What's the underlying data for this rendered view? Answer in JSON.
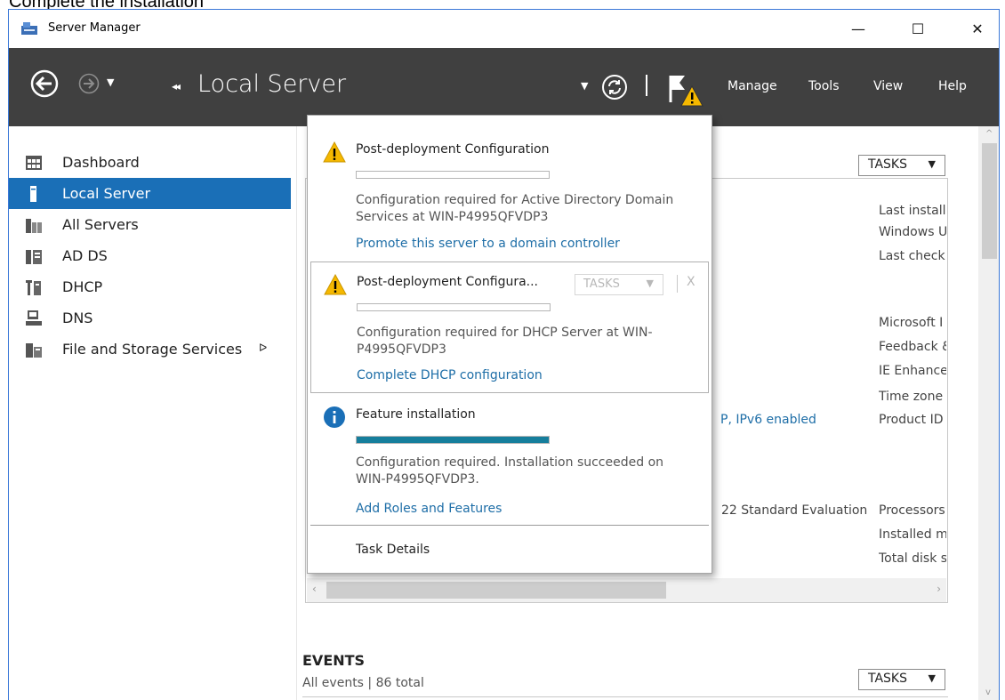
{
  "caption": "Complete the installation",
  "window": {
    "title": "Server Manager",
    "controls": {
      "minimize": "—",
      "maximize": "☐",
      "close": "✕"
    }
  },
  "header": {
    "breadcrumb_arrows": "◂◂",
    "title": "Local Server",
    "menu": [
      "Manage",
      "Tools",
      "View",
      "Help"
    ]
  },
  "sidebar": {
    "items": [
      {
        "label": "Dashboard",
        "icon": "dashboard-icon",
        "active": false
      },
      {
        "label": "Local Server",
        "icon": "local-server-icon",
        "active": true
      },
      {
        "label": "All Servers",
        "icon": "all-servers-icon",
        "active": false
      },
      {
        "label": "AD DS",
        "icon": "ad-ds-icon",
        "active": false
      },
      {
        "label": "DHCP",
        "icon": "dhcp-icon",
        "active": false
      },
      {
        "label": "DNS",
        "icon": "dns-icon",
        "active": false
      },
      {
        "label": "File and Storage Services",
        "icon": "file-storage-icon",
        "active": false,
        "chevron": "ᐅ"
      }
    ]
  },
  "properties": {
    "tasks_label": "TASKS",
    "ipv6_text": "P, IPv6 enabled",
    "os_text": "22 Standard Evaluation",
    "right_column": [
      "Last install",
      "Windows U",
      "Last check",
      "Microsoft I",
      "Feedback &",
      "IE Enhance",
      "Time zone",
      "Product ID",
      "Processors",
      "Installed m",
      "Total disk s"
    ]
  },
  "events": {
    "title": "EVENTS",
    "summary": "All events | 86 total",
    "tasks_label": "TASKS"
  },
  "notifications": [
    {
      "icon": "warning-icon",
      "title": "Post-deployment Configuration",
      "progress": 0,
      "description": "Configuration required for Active Directory Domain Services at WIN-P4995QFVDP3",
      "link": "Promote this server to a domain controller"
    },
    {
      "icon": "warning-icon",
      "title": "Post-deployment Configura...",
      "tasks_label": "TASKS",
      "close": "X",
      "progress": 0,
      "description": "Configuration required for DHCP Server at WIN-P4995QFVDP3",
      "link": "Complete DHCP configuration"
    },
    {
      "icon": "info-icon",
      "title": "Feature installation",
      "progress": 1,
      "description": "Configuration required. Installation succeeded on WIN-P4995QFVDP3.",
      "link": "Add Roles and Features"
    }
  ],
  "task_details": "Task Details",
  "colors": {
    "accent": "#1a6fb7",
    "header_bg": "#404040",
    "link": "#1e6ea7",
    "progress": "#167e9c",
    "warning": "#f5b800"
  }
}
